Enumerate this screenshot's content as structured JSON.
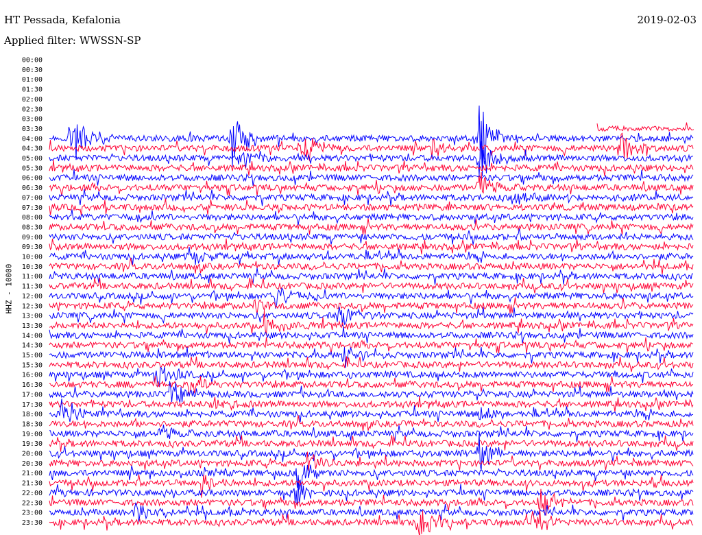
{
  "header": {
    "station": "HT Pessada, Kefalonia",
    "filter_label": "Applied filter:",
    "filter_value": "WWSSN-SP",
    "date": "2019-02-03"
  },
  "chart_data": {
    "type": "line",
    "title": "HT Pessada, Kefalonia",
    "date": "2019-02-03",
    "filter": "WWSSN-SP",
    "ylabel": "HHZ - 10000",
    "xlabel": "",
    "y_tick_labels": [
      "00:00",
      "00:30",
      "01:00",
      "01:30",
      "02:00",
      "02:30",
      "03:00",
      "03:30",
      "04:00",
      "04:30",
      "05:00",
      "05:30",
      "06:00",
      "06:30",
      "07:00",
      "07:30",
      "08:00",
      "08:30",
      "09:00",
      "09:30",
      "10:00",
      "10:30",
      "11:00",
      "11:30",
      "12:00",
      "12:30",
      "13:00",
      "13:30",
      "14:00",
      "14:30",
      "15:00",
      "15:30",
      "16:00",
      "16:30",
      "17:00",
      "17:30",
      "18:00",
      "18:30",
      "19:00",
      "19:30",
      "20:00",
      "20:30",
      "21:00",
      "21:30",
      "22:00",
      "22:30",
      "23:00",
      "23:30"
    ],
    "trace_colors": [
      "#0000ff",
      "#ff0033"
    ],
    "colors_alternate_by_row": true,
    "first_trace_row": 8,
    "partial_trace_row": 7,
    "row_minutes": 30,
    "events": [
      {
        "row": 8,
        "minute": 8.5,
        "amplitude": 1.0
      },
      {
        "row": 8,
        "minute": 20.0,
        "amplitude": 1.0
      },
      {
        "row": 8,
        "minute": 1.0,
        "amplitude": 0.9
      },
      {
        "row": 9,
        "minute": 11.8,
        "amplitude": 0.6
      },
      {
        "row": 9,
        "minute": 17.8,
        "amplitude": 0.4
      },
      {
        "row": 9,
        "minute": 26.6,
        "amplitude": 0.5
      },
      {
        "row": 10,
        "minute": 9.0,
        "amplitude": 0.4
      },
      {
        "row": 10,
        "minute": 20.0,
        "amplitude": 0.8
      },
      {
        "row": 13,
        "minute": 20.0,
        "amplitude": 0.5
      },
      {
        "row": 14,
        "minute": 21.5,
        "amplitude": 0.3
      },
      {
        "row": 20,
        "minute": 6.5,
        "amplitude": 0.3
      },
      {
        "row": 24,
        "minute": 10.5,
        "amplitude": 0.4
      },
      {
        "row": 25,
        "minute": 9.5,
        "amplitude": 0.3
      },
      {
        "row": 26,
        "minute": 13.5,
        "amplitude": 0.5
      },
      {
        "row": 27,
        "minute": 10.0,
        "amplitude": 0.4
      },
      {
        "row": 30,
        "minute": 13.6,
        "amplitude": 0.4
      },
      {
        "row": 32,
        "minute": 5.0,
        "amplitude": 0.5
      },
      {
        "row": 33,
        "minute": 6.5,
        "amplitude": 0.4
      },
      {
        "row": 34,
        "minute": 5.6,
        "amplitude": 0.4
      },
      {
        "row": 35,
        "minute": 7.5,
        "amplitude": 0.5
      },
      {
        "row": 36,
        "minute": 0.5,
        "amplitude": 0.4
      },
      {
        "row": 36,
        "minute": 20.0,
        "amplitude": 0.4
      },
      {
        "row": 38,
        "minute": 5.2,
        "amplitude": 0.3
      },
      {
        "row": 40,
        "minute": 20.0,
        "amplitude": 0.5
      },
      {
        "row": 41,
        "minute": 12.0,
        "amplitude": 0.5
      },
      {
        "row": 42,
        "minute": 11.5,
        "amplitude": 0.6
      },
      {
        "row": 43,
        "minute": 7.0,
        "amplitude": 0.4
      },
      {
        "row": 44,
        "minute": 11.3,
        "amplitude": 0.5
      },
      {
        "row": 45,
        "minute": 22.8,
        "amplitude": 0.5
      },
      {
        "row": 46,
        "minute": 4.0,
        "amplitude": 0.4
      },
      {
        "row": 47,
        "minute": 17.2,
        "amplitude": 0.6
      },
      {
        "row": 47,
        "minute": 22.5,
        "amplitude": 0.5
      }
    ]
  }
}
